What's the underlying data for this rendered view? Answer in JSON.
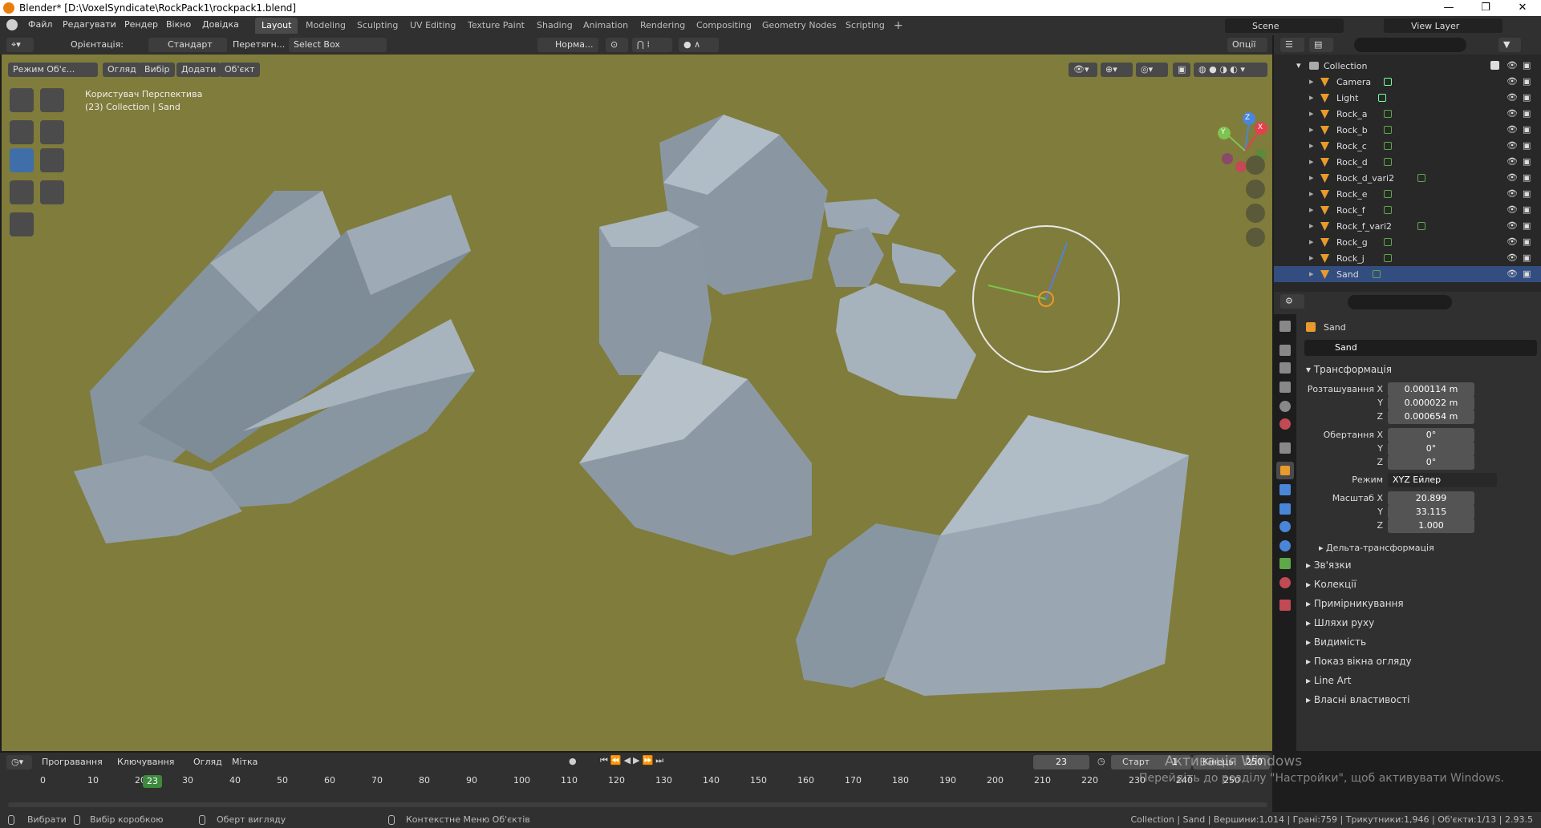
{
  "window": {
    "title": "Blender* [D:\\VoxelSyndicate\\RockPack1\\rockpack1.blend]",
    "min": "—",
    "max": "❐",
    "close": "✕"
  },
  "menu": {
    "file": "Файл",
    "edit": "Редагувати",
    "render": "Рендер",
    "window": "Вікно",
    "help": "Довідка"
  },
  "workspaces": [
    "Layout",
    "Modeling",
    "Sculpting",
    "UV Editing",
    "Texture Paint",
    "Shading",
    "Animation",
    "Rendering",
    "Compositing",
    "Geometry Nodes",
    "Scripting",
    "+"
  ],
  "scene": {
    "name": "Scene",
    "view_layer": "View Layer"
  },
  "header": {
    "orientation_label": "Орієнтація:",
    "orientation_value": "Стандарт",
    "drag_label": "Перетягн...",
    "drag_value": "Select Box",
    "normal": "Норма...",
    "options": "Опції"
  },
  "viewport": {
    "mode": "Режим Об'є...",
    "view": "Огляд",
    "select": "Вибір",
    "add": "Додати",
    "object": "Об'єкт",
    "persp_line1": "Користувач Перспектива",
    "persp_line2": "(23) Collection | Sand",
    "gizmo_x": "X",
    "gizmo_y": "Y",
    "gizmo_z": "Z"
  },
  "outliner": {
    "root": "Collection",
    "items": [
      {
        "name": "Camera",
        "type": "camera"
      },
      {
        "name": "Light",
        "type": "light"
      },
      {
        "name": "Rock_a",
        "type": "mesh"
      },
      {
        "name": "Rock_b",
        "type": "mesh"
      },
      {
        "name": "Rock_c",
        "type": "mesh"
      },
      {
        "name": "Rock_d",
        "type": "mesh"
      },
      {
        "name": "Rock_d_vari2",
        "type": "mesh"
      },
      {
        "name": "Rock_e",
        "type": "mesh"
      },
      {
        "name": "Rock_f",
        "type": "mesh"
      },
      {
        "name": "Rock_f_vari2",
        "type": "mesh"
      },
      {
        "name": "Rock_g",
        "type": "mesh"
      },
      {
        "name": "Rock_j",
        "type": "mesh"
      },
      {
        "name": "Sand",
        "type": "mesh",
        "selected": true
      }
    ]
  },
  "properties": {
    "object_name": "Sand",
    "datablock": "Sand",
    "transform_title": "Трансформація",
    "loc_label": "Розташування X",
    "loc": [
      "0.000114 m",
      "0.000022 m",
      "0.000654 m"
    ],
    "rot_label": "Обертання X",
    "rot": [
      "0°",
      "0°",
      "0°"
    ],
    "mode_label": "Режим",
    "mode_value": "XYZ Ейлер",
    "scale_label": "Масштаб X",
    "scale": [
      "20.899",
      "33.115",
      "1.000"
    ],
    "y": "Y",
    "z": "Z",
    "delta": "Дельта-трансформація",
    "sections": [
      "Зв'язки",
      "Колекції",
      "Примірникування",
      "Шляхи руху",
      "Видимість",
      "Показ вікна огляду",
      "Line Art",
      "Власні властивості"
    ]
  },
  "timeline": {
    "playback": "Програвання",
    "keying": "Ключування",
    "view": "Огляд",
    "marker": "Мітка",
    "current": "23",
    "start_label": "Старт",
    "start": "1",
    "end_label": "Кінець",
    "end": "250",
    "ticks": [
      "0",
      "10",
      "20",
      "30",
      "40",
      "50",
      "60",
      "70",
      "80",
      "90",
      "100",
      "110",
      "120",
      "130",
      "140",
      "150",
      "160",
      "170",
      "180",
      "190",
      "200",
      "210",
      "220",
      "230",
      "240",
      "250"
    ],
    "frame_marker": "23"
  },
  "status": {
    "select": "Вибрати",
    "box": "Вибір коробкою",
    "rotate": "Оберт вигляду",
    "ctx": "Контекстне Меню Об'єктів",
    "stats": "Collection | Sand | Вершини:1,014 | Грані:759 | Трикутники:1,946 | Об'єкти:1/13 | 2.93.5"
  },
  "activation": {
    "line1": "Активація Windows",
    "line2": "Перейдіть до розділу \"Настройки\", щоб активувати Windows."
  },
  "colors": {
    "accent": "#4772b3",
    "viewport_bg": "#807c3b",
    "rock": "#8d9aa5",
    "selected_row": "#334d80"
  }
}
